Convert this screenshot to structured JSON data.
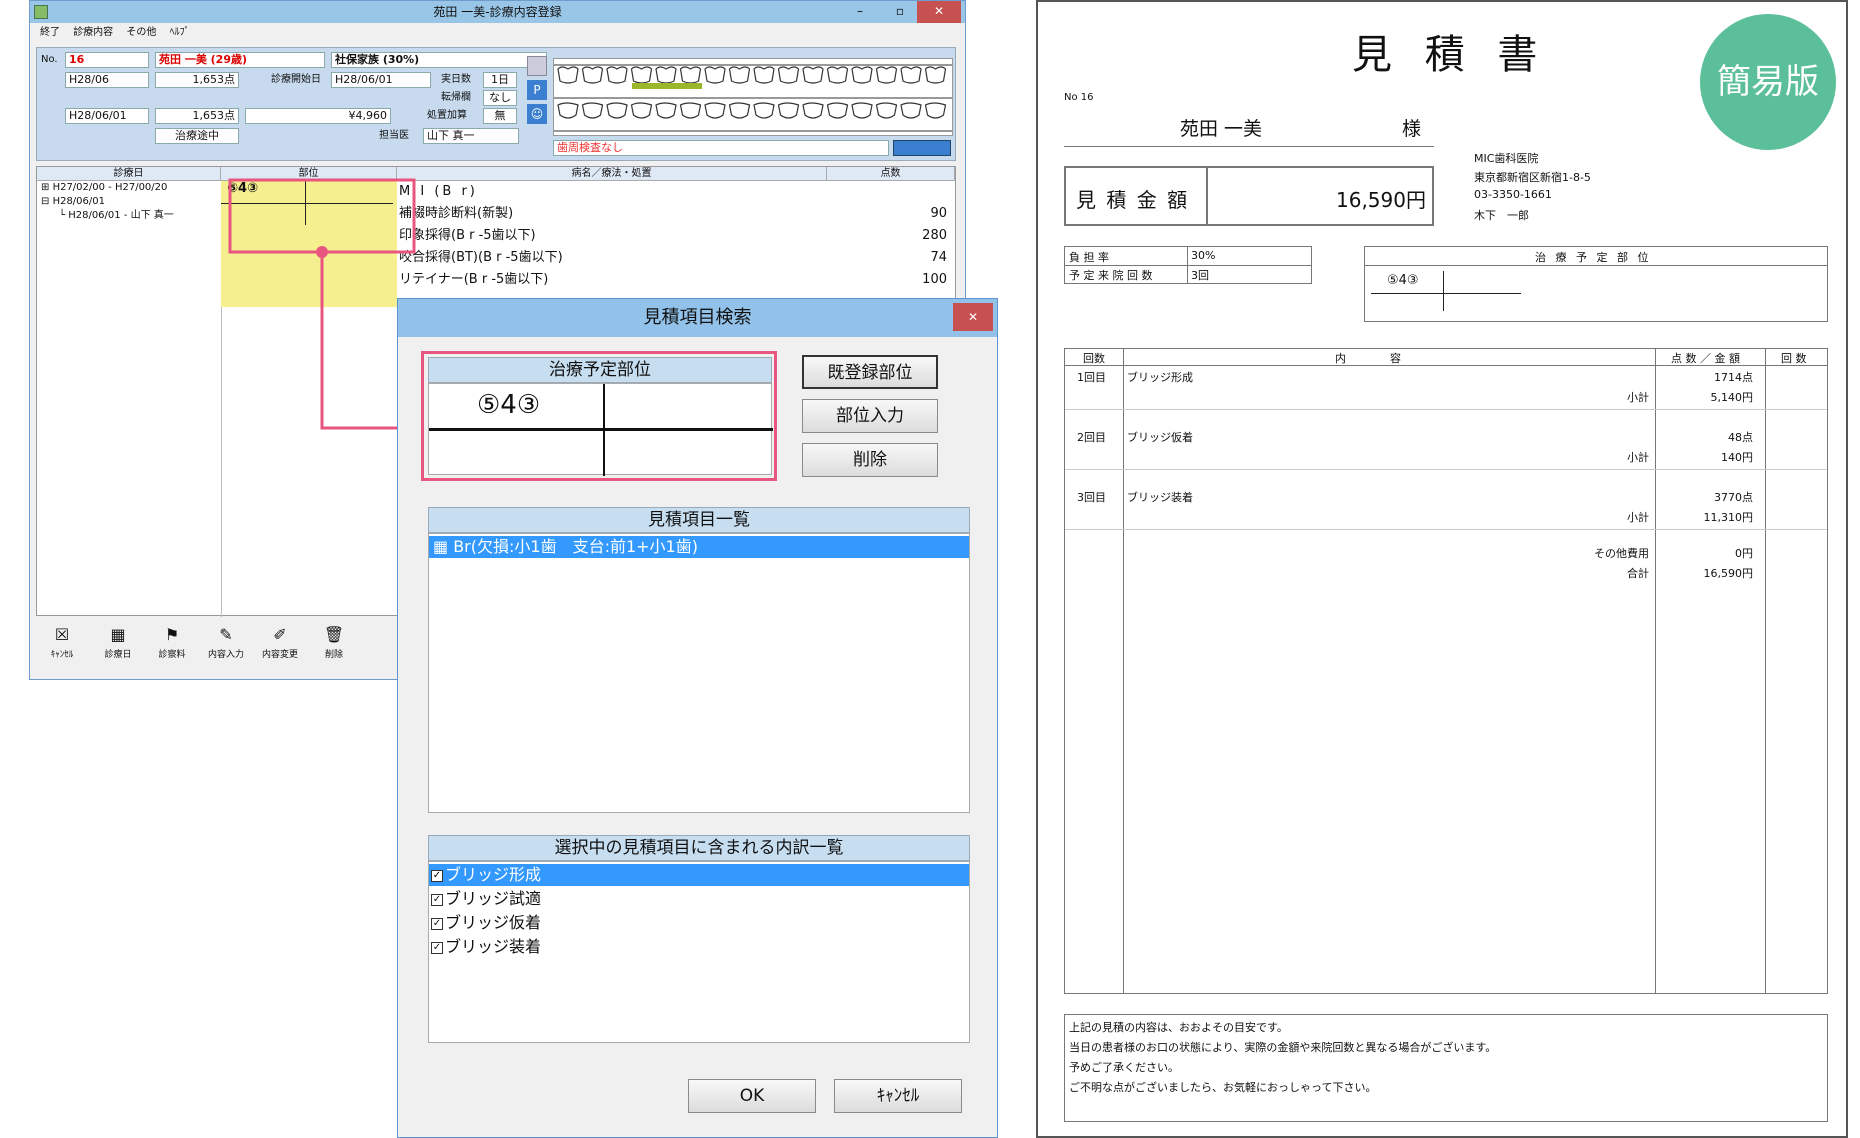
{
  "main_window": {
    "title": "苑田 一美-診療内容登録",
    "menu": [
      "終了",
      "診療内容",
      "その他",
      "ﾍﾙﾌﾟ"
    ],
    "patient": {
      "no_label": "No.",
      "no": "16",
      "name": "苑田 一美 (29歳)",
      "insurance": "社保家族 (30%)",
      "date1": "H28/06",
      "points1": "1,653点",
      "start_label": "診療開始日",
      "start_date": "H28/06/01",
      "days_label": "実日数",
      "days": "1日",
      "transfer_label": "転帰欄",
      "transfer": "なし",
      "date2": "H28/06/01",
      "points2": "1,653点",
      "amount": "¥4,960",
      "addition_label": "処置加算",
      "addition": "無",
      "status": "治療途中",
      "doctor_label": "担当医",
      "doctor": "山下 真一",
      "perio_note": "歯周検査なし"
    },
    "grid_headers": [
      "診療日",
      "部位",
      "病名／療法・処置",
      "点数"
    ],
    "tree": [
      "H27/02/00 - H27/00/20",
      "H28/06/01",
      "H28/06/01 - 山下 真一"
    ],
    "site_value": "⑤4③",
    "rows": [
      {
        "text": "M I (B r)",
        "points": ""
      },
      {
        "text": "補綴時診断料(新製)",
        "points": "90"
      },
      {
        "text": "印象採得(B r -5歯以下)",
        "points": "280"
      },
      {
        "text": "咬合採得(BT)(B r -5歯以下)",
        "points": "74"
      },
      {
        "text": "リテイナー(B r -5歯以下)",
        "points": "100"
      }
    ],
    "toolbar": [
      "ｷｬﾝｾﾙ",
      "診療日",
      "診察料",
      "内容入力",
      "内容変更",
      "削除"
    ]
  },
  "dialog": {
    "title": "見積項目検索",
    "site_header": "治療予定部位",
    "site_value": "⑤4③",
    "buttons": {
      "registered": "既登録部位",
      "input": "部位入力",
      "delete": "削除",
      "ok": "OK",
      "cancel": "ｷｬﾝｾﾙ"
    },
    "list_header": "見積項目一覧",
    "list_items": [
      "Br(欠損:小1歯　支台:前1+小1歯)"
    ],
    "detail_header": "選択中の見積項目に含まれる内訳一覧",
    "detail_items": [
      "ブリッジ形成",
      "ブリッジ試適",
      "ブリッジ仮着",
      "ブリッジ装着"
    ]
  },
  "estimate": {
    "title": "見 積 書",
    "badge": "簡易版",
    "no": "No 16",
    "patient_name": "苑田 一美",
    "honorific": "様",
    "amount_label": "見 積 金 額",
    "amount": "16,590円",
    "clinic": [
      "MIC歯科医院",
      "東京都新宿区新宿1-8-5",
      "03-3350-1661",
      "木下　一郎"
    ],
    "burden_label": "負 担 率",
    "burden": "30%",
    "visits_label": "予 定 来 院 回 数",
    "visits": "3回",
    "site_header": "治 療 予 定 部 位",
    "site_value": "⑤4③",
    "table_headers": [
      "回数",
      "内　　　　容",
      "点 数 ／ 金 額",
      "回 数"
    ],
    "rows": [
      {
        "visit": "1回目",
        "content": "ブリッジ形成",
        "points": "1714点",
        "subtotal_label": "小計",
        "subtotal": "5,140円"
      },
      {
        "visit": "2回目",
        "content": "ブリッジ仮着",
        "points": "48点",
        "subtotal_label": "小計",
        "subtotal": "140円"
      },
      {
        "visit": "3回目",
        "content": "ブリッジ装着",
        "points": "3770点",
        "subtotal_label": "小計",
        "subtotal": "11,310円"
      }
    ],
    "other_label": "その他費用",
    "other": "0円",
    "total_label": "合計",
    "total": "16,590円",
    "notes": [
      "上記の見積の内容は、おおよその目安です。",
      "当日の患者様のお口の状態により、実際の金額や来院回数と異なる場合がございます。",
      "予めご了承ください。",
      "ご不明な点がございましたら、お気軽におっしゃって下さい。"
    ]
  },
  "colors": {
    "highlight": "#f5ef8f",
    "callout": "#e8557f",
    "badge": "#5bbf99"
  }
}
